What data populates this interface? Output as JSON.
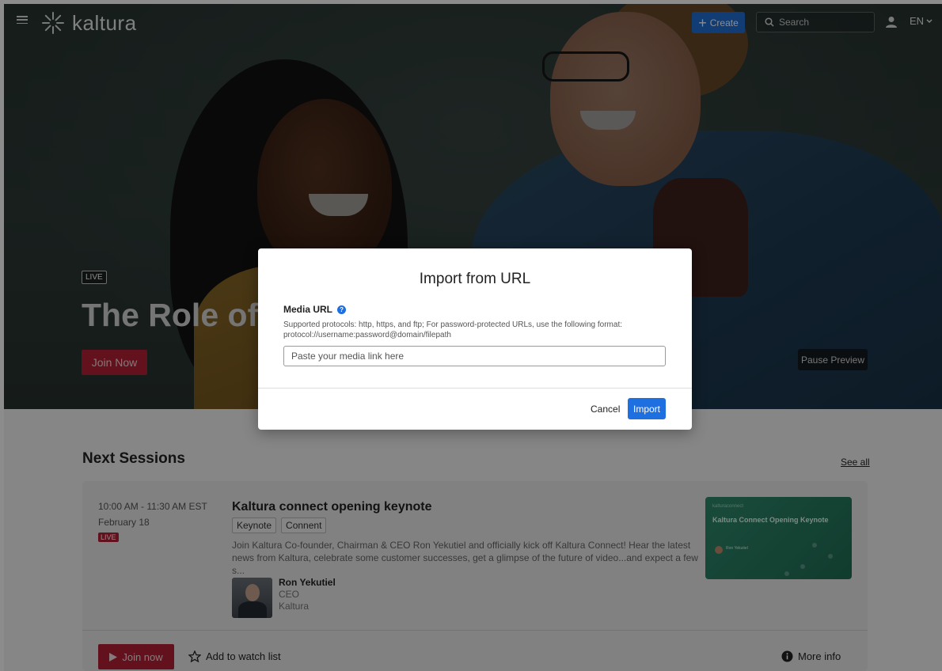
{
  "topnav": {
    "logo_text": "kaltura",
    "create_label": "Create",
    "search_placeholder": "Search",
    "language": "EN"
  },
  "hero": {
    "live_tag": "LIVE",
    "title": "The Role of S",
    "join_label": "Join Now",
    "pause_label": "Pause Preview"
  },
  "sessions": {
    "heading": "Next Sessions",
    "see_all": "See all",
    "card": {
      "time": "10:00 AM - 11:30 AM EST",
      "date": "February 18",
      "live_badge": "LIVE",
      "title": "Kaltura connect opening keynote",
      "tags": [
        "Keynote",
        "Connent"
      ],
      "description": "Join Kaltura Co-founder, Chairman & CEO Ron Yekutiel and officially kick off Kaltura Connect! Hear the latest news from Kaltura, celebrate some customer successes, get a glimpse of the future of video...and expect a few s...",
      "speaker": {
        "name": "Ron Yekutiel",
        "role": "CEO",
        "company": "Kaltura"
      },
      "thumbnail": {
        "brand": "kalturaconnect",
        "title": "Kaltura Connect Opening Keynote",
        "speaker": "Ron Yekutiel"
      },
      "join_label": "Join now",
      "watchlist_label": "Add to watch list",
      "more_info_label": "More info"
    }
  },
  "modal": {
    "title": "Import from URL",
    "field_label": "Media URL",
    "help_text": "Supported protocols: http, https, and ftp; For password-protected URLs, use the following format: protocol://username:password@domain/filepath",
    "input_placeholder": "Paste your media link here",
    "input_value": "",
    "cancel_label": "Cancel",
    "import_label": "Import"
  },
  "colors": {
    "accent_blue": "#1e6fe0",
    "live_red": "#b32036"
  },
  "icons": [
    "hamburger-icon",
    "kaltura-logo-icon",
    "plus-icon",
    "search-icon",
    "user-icon",
    "chevron-down-icon",
    "help-icon",
    "play-icon",
    "star-icon",
    "info-icon"
  ]
}
